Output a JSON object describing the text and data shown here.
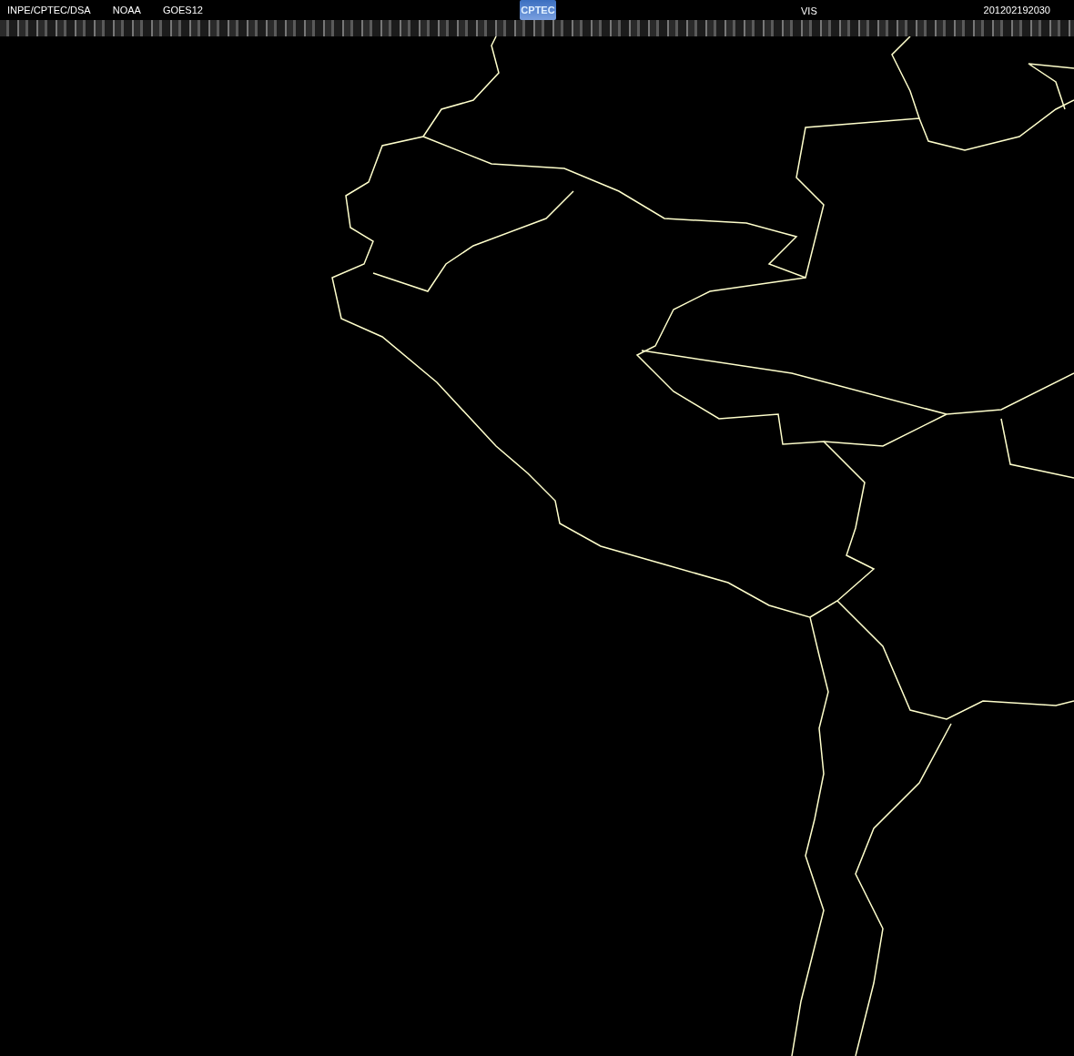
{
  "header": {
    "source": "INPE/CPTEC/DSA",
    "agency": "NOAA",
    "satellite": "GOES12",
    "logo": "CPTEC",
    "channel": "VIS",
    "timestamp": "201202192030"
  }
}
